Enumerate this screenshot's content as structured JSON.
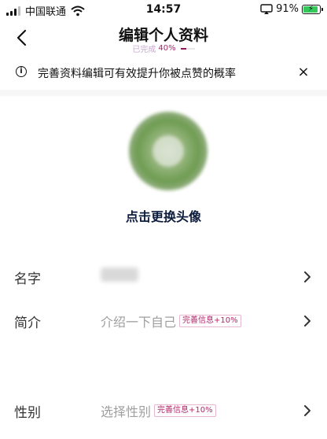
{
  "status_bar": {
    "carrier": "中国联通",
    "time": "14:57",
    "battery_pct": "91%",
    "battery_level": 0.91
  },
  "nav": {
    "title": "编辑个人资料",
    "progress_label": "已完成",
    "progress_pct": "40%",
    "progress_value": 0.4
  },
  "tip": {
    "text": "完善资料编辑可有效提升你被点赞的概率",
    "close_label": "×"
  },
  "avatar": {
    "change_label": "点击更换头像"
  },
  "fields": [
    {
      "label": "名字",
      "value": "",
      "placeholder": "",
      "badge": ""
    },
    {
      "label": "简介",
      "value": "",
      "placeholder": "介绍一下自己",
      "badge": "完善信息+10%"
    },
    {
      "label": "性别",
      "value": "",
      "placeholder": "选择性别",
      "badge": "完善信息+10%"
    }
  ],
  "icons": {
    "back": "chevron-left-icon",
    "info": "info-icon",
    "close": "close-icon",
    "row_chevron": "chevron-right-icon",
    "wifi": "wifi-icon",
    "cast": "screen-mirror-icon",
    "battery": "battery-charging-icon"
  },
  "colors": {
    "accent": "#8b1a5a",
    "badge_text": "#b0286a",
    "battery_fill": "#34c759"
  }
}
